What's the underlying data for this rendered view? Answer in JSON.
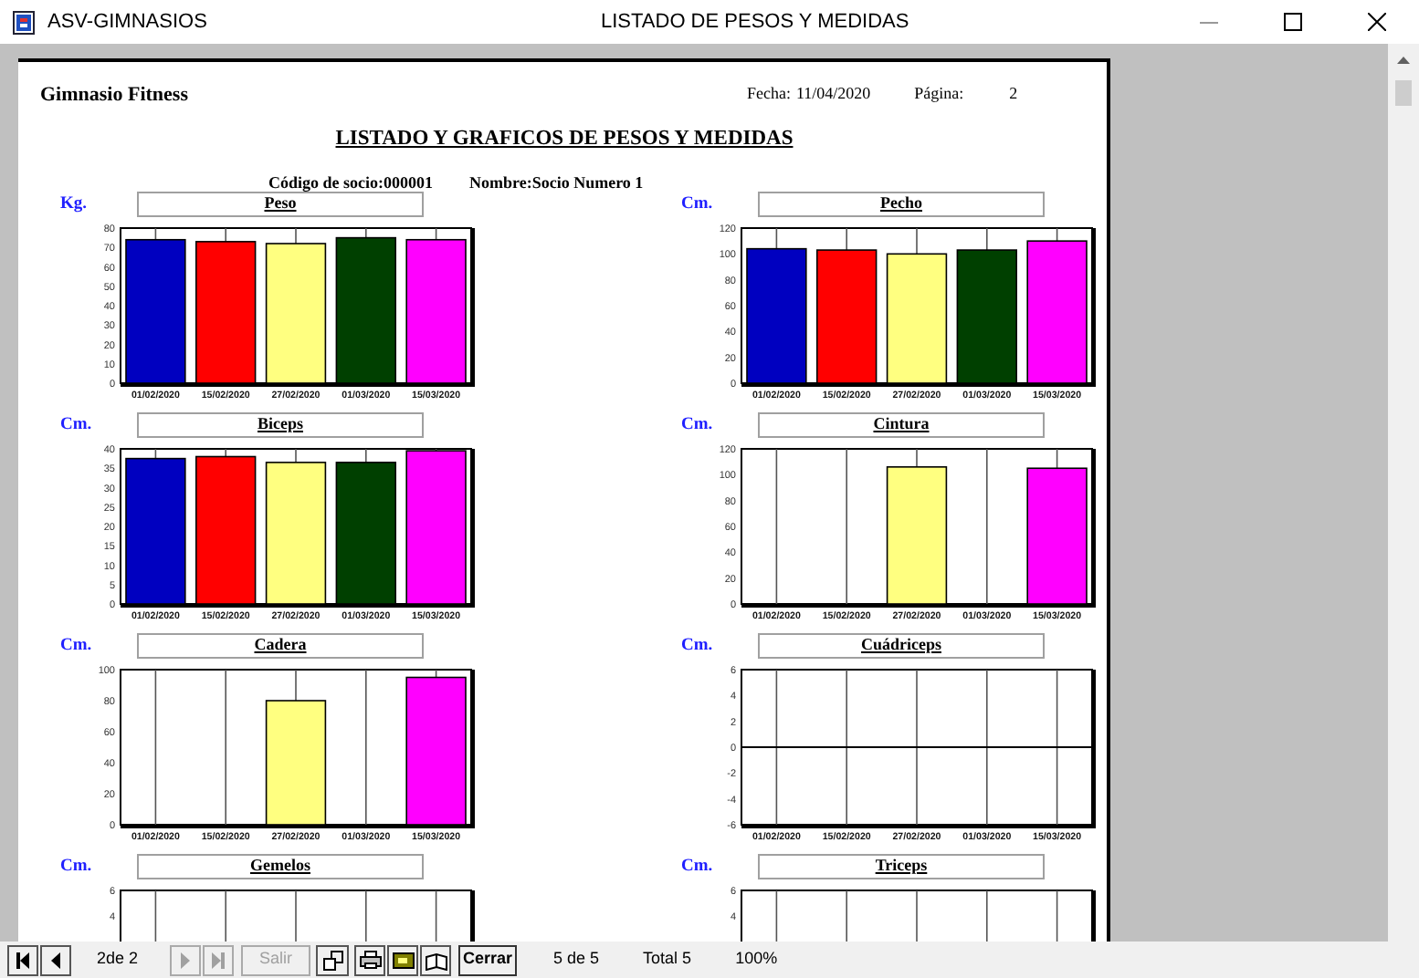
{
  "window": {
    "app_name": "ASV-GIMNASIOS",
    "title": "LISTADO DE PESOS Y MEDIDAS"
  },
  "report": {
    "company": "Gimnasio Fitness",
    "date_label": "Fecha:",
    "date": "11/04/2020",
    "page_label": "Página:",
    "page": "2",
    "heading": "LISTADO Y GRAFICOS DE PESOS Y MEDIDAS",
    "member_code": "Código de socio:000001",
    "member_name": "Nombre:Socio Numero 1",
    "charts": [
      {
        "unit": "Kg.",
        "chart_data": {
          "type": "bar",
          "title": "Peso",
          "grid": true,
          "categories": [
            null
          ],
          "series": [
            {
              "name": "01/02/2020",
              "color": "#0000c0",
              "values": [
                74
              ]
            },
            {
              "name": "15/02/2020",
              "color": "#ff0000",
              "values": [
                73
              ]
            },
            {
              "name": "27/02/2020",
              "color": "#ffff80",
              "values": [
                72
              ]
            },
            {
              "name": "01/03/2020",
              "color": "#004000",
              "values": [
                75
              ]
            },
            {
              "name": "15/03/2020",
              "color": "#ff00ff",
              "values": [
                74
              ]
            }
          ],
          "ylim": [
            0,
            80
          ],
          "yticks": [
            0,
            10,
            20,
            30,
            40,
            50,
            60,
            70,
            80
          ]
        }
      },
      {
        "unit": "Cm.",
        "chart_data": {
          "type": "bar",
          "title": "Pecho",
          "grid": true,
          "categories": [
            null
          ],
          "series": [
            {
              "name": "01/02/2020",
              "color": "#0000c0",
              "values": [
                104
              ]
            },
            {
              "name": "15/02/2020",
              "color": "#ff0000",
              "values": [
                103
              ]
            },
            {
              "name": "27/02/2020",
              "color": "#ffff80",
              "values": [
                100
              ]
            },
            {
              "name": "01/03/2020",
              "color": "#004000",
              "values": [
                103
              ]
            },
            {
              "name": "15/03/2020",
              "color": "#ff00ff",
              "values": [
                110
              ]
            }
          ],
          "ylim": [
            0,
            120
          ],
          "yticks": [
            0,
            20,
            40,
            60,
            80,
            100,
            120
          ]
        }
      },
      {
        "unit": "Cm.",
        "chart_data": {
          "type": "bar",
          "title": "Biceps",
          "grid": true,
          "categories": [
            null
          ],
          "series": [
            {
              "name": "01/02/2020",
              "color": "#0000c0",
              "values": [
                37.5
              ]
            },
            {
              "name": "15/02/2020",
              "color": "#ff0000",
              "values": [
                38
              ]
            },
            {
              "name": "27/02/2020",
              "color": "#ffff80",
              "values": [
                36.5
              ]
            },
            {
              "name": "01/03/2020",
              "color": "#004000",
              "values": [
                36.5
              ]
            },
            {
              "name": "15/03/2020",
              "color": "#ff00ff",
              "values": [
                39.5
              ]
            }
          ],
          "ylim": [
            0,
            40
          ],
          "yticks": [
            0,
            5,
            10,
            15,
            20,
            25,
            30,
            35,
            40
          ]
        }
      },
      {
        "unit": "Cm.",
        "chart_data": {
          "type": "bar",
          "title": "Cintura",
          "grid": true,
          "categories": [
            null
          ],
          "series": [
            {
              "name": "01/02/2020",
              "values": [
                null
              ]
            },
            {
              "name": "15/02/2020",
              "values": [
                null
              ]
            },
            {
              "name": "27/02/2020",
              "color": "#ffff80",
              "values": [
                106
              ]
            },
            {
              "name": "01/03/2020",
              "values": [
                null
              ]
            },
            {
              "name": "15/03/2020",
              "color": "#ff00ff",
              "values": [
                105
              ]
            }
          ],
          "ylim": [
            0,
            120
          ],
          "yticks": [
            0,
            20,
            40,
            60,
            80,
            100,
            120
          ]
        }
      },
      {
        "unit": "Cm.",
        "chart_data": {
          "type": "bar",
          "title": "Cadera",
          "grid": true,
          "categories": [
            null
          ],
          "series": [
            {
              "name": "01/02/2020",
              "values": [
                null
              ]
            },
            {
              "name": "15/02/2020",
              "values": [
                null
              ]
            },
            {
              "name": "27/02/2020",
              "color": "#ffff80",
              "values": [
                80
              ]
            },
            {
              "name": "01/03/2020",
              "values": [
                null
              ]
            },
            {
              "name": "15/03/2020",
              "color": "#ff00ff",
              "values": [
                95
              ]
            }
          ],
          "ylim": [
            0,
            100
          ],
          "yticks": [
            0,
            20,
            40,
            60,
            80,
            100
          ]
        }
      },
      {
        "unit": "Cm.",
        "chart_data": {
          "type": "bar",
          "title": "Cuádriceps",
          "grid": true,
          "categories": [
            null
          ],
          "series": [
            {
              "name": "01/02/2020",
              "values": [
                null
              ]
            },
            {
              "name": "15/02/2020",
              "values": [
                null
              ]
            },
            {
              "name": "27/02/2020",
              "values": [
                null
              ]
            },
            {
              "name": "01/03/2020",
              "values": [
                null
              ]
            },
            {
              "name": "15/03/2020",
              "values": [
                null
              ]
            }
          ],
          "ylim": [
            -6,
            6
          ],
          "yticks": [
            -6,
            -4,
            -2,
            0,
            2,
            4,
            6
          ]
        }
      },
      {
        "unit": "Cm.",
        "chart_data": {
          "type": "bar",
          "title": "Gemelos",
          "grid": true,
          "categories": [
            null,
            null,
            null,
            null,
            null
          ],
          "ylim": [
            -6,
            6
          ],
          "yticks": [
            4,
            6
          ]
        }
      },
      {
        "unit": "Cm.",
        "chart_data": {
          "type": "bar",
          "title": "Triceps",
          "grid": true,
          "categories": [
            null,
            null,
            null,
            null,
            null
          ],
          "ylim": [
            -6,
            6
          ],
          "yticks": [
            4,
            6
          ]
        }
      }
    ]
  },
  "toolbar": {
    "page_indicator": "2de 2",
    "exit_button": "Salir",
    "close_button": "Cerrar",
    "record": "5 de 5",
    "total": "Total 5",
    "zoom": "100%"
  }
}
